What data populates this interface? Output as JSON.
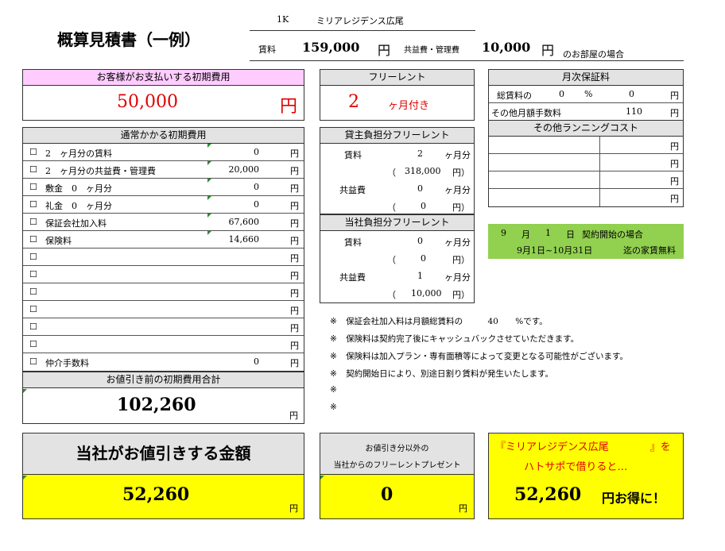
{
  "title": "概算見積書（一例）",
  "property": {
    "layout": "1K",
    "name": "ミリアレジデンス広尾",
    "rent_label": "賃料",
    "rent_value": "159,000",
    "yen": "円",
    "fee_label": "共益費・管理費",
    "fee_value": "10,000",
    "room_case": "のお部屋の場合"
  },
  "customer_initial": {
    "header": "お客様がお支払いする初期費用",
    "amount": "50,000",
    "unit": "円"
  },
  "free_rent": {
    "header": "フリーレント",
    "months": "2",
    "suffix": "ヶ月付き"
  },
  "monthly_guarantee": {
    "header": "月次保証料",
    "row1_label": "総賃料の",
    "row1_pct": "0",
    "row1_pct_unit": "%",
    "row1_value": "0",
    "row1_unit": "円",
    "row2_label": "その他月額手数料",
    "row2_value": "110",
    "row2_unit": "円"
  },
  "running_cost": {
    "header": "その他ランニングコスト",
    "rows": [
      {
        "unit": "円"
      },
      {
        "unit": "円"
      },
      {
        "unit": "円"
      },
      {
        "unit": "円"
      }
    ]
  },
  "normal_costs": {
    "header": "通常かかる初期費用",
    "rows": [
      {
        "check": "☐",
        "label": "2　ヶ月分の賃料",
        "value": "0",
        "unit": "円"
      },
      {
        "check": "☐",
        "label": "2　ヶ月分の共益費・管理費",
        "value": "20,000",
        "unit": "円"
      },
      {
        "check": "☐",
        "label": "敷金　0　ヶ月分",
        "value": "0",
        "unit": "円"
      },
      {
        "check": "☐",
        "label": "礼金　0　ヶ月分",
        "value": "0",
        "unit": "円"
      },
      {
        "check": "☐",
        "label": "保証会社加入料",
        "value": "67,600",
        "unit": "円"
      },
      {
        "check": "☐",
        "label": "保険料",
        "value": "14,660",
        "unit": "円"
      },
      {
        "check": "☐",
        "label": "",
        "value": "",
        "unit": "円"
      },
      {
        "check": "☐",
        "label": "",
        "value": "",
        "unit": "円"
      },
      {
        "check": "☐",
        "label": "",
        "value": "",
        "unit": "円"
      },
      {
        "check": "☐",
        "label": "",
        "value": "",
        "unit": "円"
      },
      {
        "check": "☐",
        "label": "",
        "value": "",
        "unit": "円"
      },
      {
        "check": "☐",
        "label": "",
        "value": "",
        "unit": "円"
      },
      {
        "check": "☐",
        "label": "仲介手数料",
        "value": "0",
        "unit": "円"
      }
    ]
  },
  "total_before": {
    "header": "お値引き前の初期費用合計",
    "amount": "102,260",
    "unit": "円"
  },
  "owner_free_rent": {
    "header": "貸主負担分フリーレント",
    "rent_label": "賃料",
    "rent_months": "2",
    "rent_months_unit": "ヶ月分",
    "rent_amount": "318,000",
    "fee_label": "共益費",
    "fee_months": "0",
    "fee_months_unit": "ヶ月分",
    "fee_amount": "0",
    "open_paren": "（",
    "close_paren": "円）"
  },
  "company_free_rent": {
    "header": "当社負担分フリーレント",
    "rent_label": "賃料",
    "rent_months": "0",
    "rent_months_unit": "ヶ月分",
    "rent_amount": "0",
    "fee_label": "共益費",
    "fee_months": "1",
    "fee_months_unit": "ヶ月分",
    "fee_amount": "10,000",
    "open_paren": "（",
    "close_paren": "円）"
  },
  "contract_start": {
    "month": "9",
    "month_label": "月",
    "day": "1",
    "day_label": "日",
    "suffix": "契約開始の場合",
    "period": "9月1日~10月31日",
    "free_text": "迄の家賃無料"
  },
  "notes": {
    "mark": "※",
    "n1_pre": "保証会社加入料は月額総賃料の",
    "n1_pct": "40",
    "n1_post": "%です。",
    "n2": "保険料は契約完了後にキャッシュバックさせていただきます。",
    "n3": "保険料は加入プラン・専有面積等によって変更となる可能性がございます。",
    "n4": "契約開始日により、別途日割り賃料が発生いたします。"
  },
  "discount": {
    "header": "当社がお値引きする金額",
    "amount": "52,260",
    "unit": "円"
  },
  "present": {
    "line1": "お値引き分以外の",
    "line2": "当社からのフリーレントプレゼント",
    "amount": "0",
    "unit": "円"
  },
  "savings": {
    "line1_open": "『",
    "line1_name": "ミリアレジデンス広尾",
    "line1_close": "』を",
    "line2": "ハトサポで借りると…",
    "amount": "52,260",
    "suffix": "円お得に！"
  },
  "colors": {
    "pink": "#ffccff",
    "gray": "#e3e3e3",
    "yellow": "#ffff00",
    "green": "#92d050",
    "red": "#e00000"
  }
}
